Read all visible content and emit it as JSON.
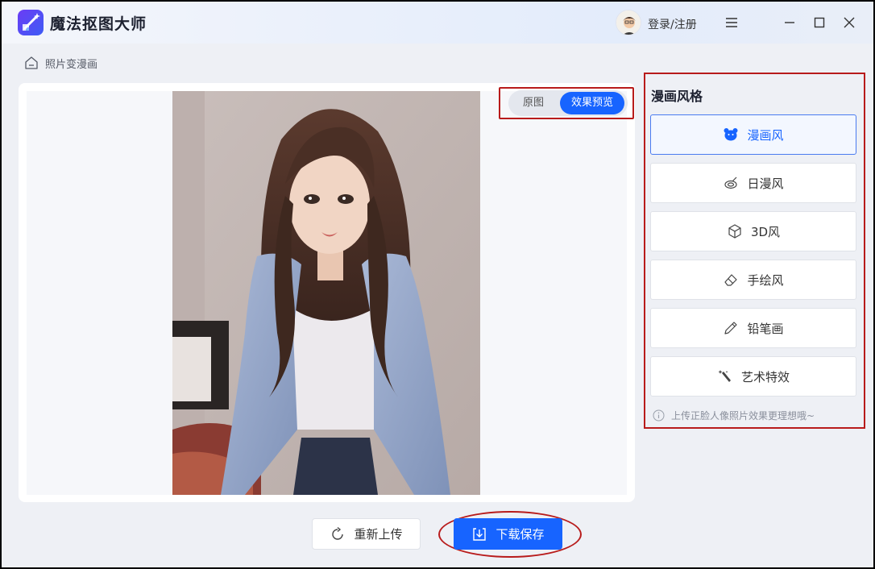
{
  "app": {
    "title": "魔法抠图大师",
    "login_label": "登录/注册"
  },
  "breadcrumb": {
    "label": "照片变漫画"
  },
  "preview": {
    "toggle_original": "原图",
    "toggle_effect": "效果预览",
    "active_toggle": "效果预览"
  },
  "style_panel": {
    "title": "漫画风格",
    "options": [
      {
        "label": "漫画风",
        "icon": "bear-icon",
        "active": true
      },
      {
        "label": "日漫风",
        "icon": "swirl-icon",
        "active": false
      },
      {
        "label": "3D风",
        "icon": "cube-icon",
        "active": false
      },
      {
        "label": "手绘风",
        "icon": "eraser-icon",
        "active": false
      },
      {
        "label": "铅笔画",
        "icon": "pencil-icon",
        "active": false
      },
      {
        "label": "艺术特效",
        "icon": "magic-wand-icon",
        "active": false
      }
    ],
    "hint": "上传正脸人像照片效果更理想哦~"
  },
  "actions": {
    "reupload_label": "重新上传",
    "download_label": "下载保存"
  },
  "colors": {
    "accent": "#1764ff",
    "highlight_border": "#b81b1b",
    "panel_bg": "#eef0f5"
  }
}
